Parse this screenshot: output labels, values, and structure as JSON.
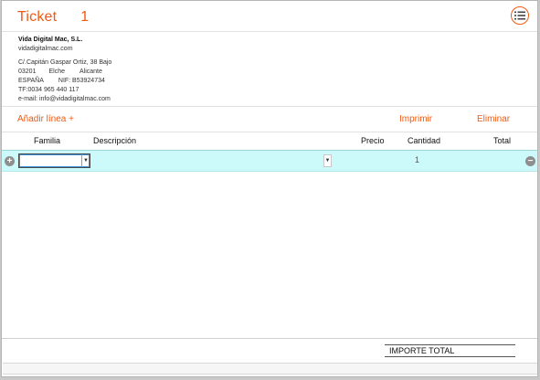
{
  "ticket": {
    "label": "Ticket",
    "number": "1"
  },
  "company": {
    "name": "Vida Digital Mac, S.L.",
    "website": "vidadigitalmac.com",
    "address": "C/.Capitán Gaspar Ortiz, 38 Bajo",
    "postal_code": "03201",
    "city": "Elche",
    "province": "Alicante",
    "country": "ESPAÑA",
    "nif": "NIF: B53924734",
    "phone": "TF:0034 965 440 117",
    "email": "e-mail: info@vidadigitalmac.com"
  },
  "actions": {
    "add_line": "Añadir línea +",
    "print": "Imprimir",
    "delete": "Eliminar"
  },
  "table": {
    "headers": {
      "familia": "Familia",
      "descripcion": "Descripción",
      "precio": "Precio",
      "cantidad": "Cantidad",
      "total": "Total"
    },
    "rows": [
      {
        "familia": "",
        "descripcion": "",
        "precio": "",
        "cantidad": "1",
        "total": ""
      }
    ]
  },
  "footer": {
    "importe_total_label": "IMPORTE TOTAL"
  },
  "icons": {
    "menu": "list-menu-icon",
    "add_row": "plus-circle-icon",
    "remove_row": "minus-circle-icon"
  },
  "colors": {
    "accent": "#f05a14",
    "row_highlight": "#ccfafa"
  }
}
